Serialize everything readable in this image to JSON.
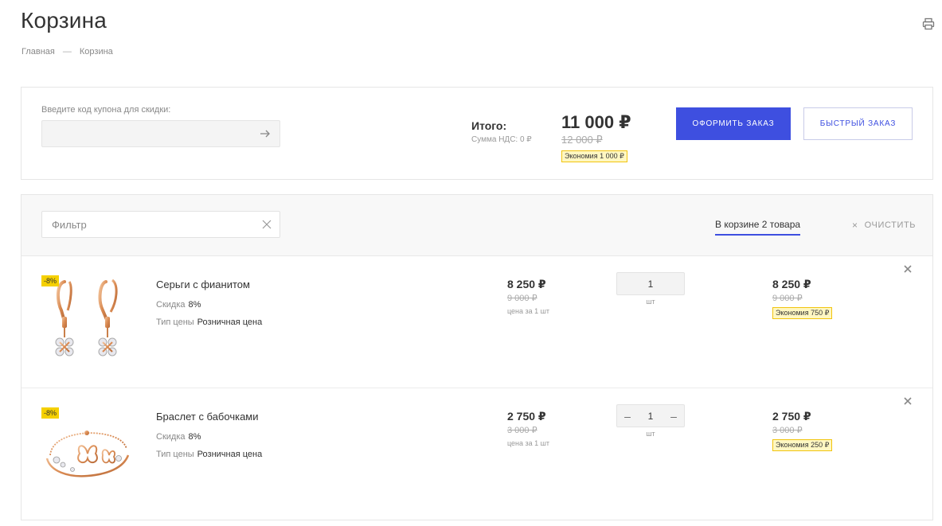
{
  "page": {
    "title": "Корзина",
    "breadcrumb": [
      "Главная",
      "—",
      "Корзина"
    ]
  },
  "summary": {
    "coupon_label": "Введите код купона для скидки:",
    "coupon_value": "",
    "total_label": "Итого:",
    "vat_label": "Сумма НДС: 0 ₽",
    "total_price": "11 000 ₽",
    "total_old_price": "12 000 ₽",
    "total_economy": "Экономия 1 000 ₽",
    "checkout_label": "Оформить заказ",
    "quick_order_label": "Быстрый заказ"
  },
  "cart": {
    "filter_placeholder": "Фильтр",
    "count_label": "В корзине 2 товара",
    "clear_label": "очистить",
    "items": [
      {
        "discount_tag": "-8%",
        "name": "Серьги с фианитом",
        "prop1_label": "Скидка",
        "prop1_value": "8%",
        "prop2_label": "Тип цены",
        "prop2_value": "Розничная цена",
        "price": "8 250 ₽",
        "old_price": "9 000 ₽",
        "price_per": "цена за 1 шт",
        "quantity": "1",
        "unit": "шт",
        "sum": "8 250 ₽",
        "sum_old": "9 000 ₽",
        "economy": "Экономия 750 ₽"
      },
      {
        "discount_tag": "-8%",
        "name": "Браслет с бабочками",
        "prop1_label": "Скидка",
        "prop1_value": "8%",
        "prop2_label": "Тип цены",
        "prop2_value": "Розничная цена",
        "price": "2 750 ₽",
        "old_price": "3 000 ₽",
        "price_per": "цена за 1 шт",
        "quantity": "1",
        "unit": "шт",
        "sum": "2 750 ₽",
        "sum_old": "3 000 ₽",
        "economy": "Экономия 250 ₽"
      }
    ]
  },
  "icons": {
    "print": "printer-icon",
    "coupon_submit": "arrow-right-icon",
    "filter_clear": "close-icon",
    "row_delete": "close-icon",
    "qty_minus": "minus-icon"
  },
  "colors": {
    "accent": "#3e4fe0",
    "badge_bg": "#fff7c2",
    "badge_border": "#f1c40f",
    "discount_tag": "#f5d000"
  }
}
